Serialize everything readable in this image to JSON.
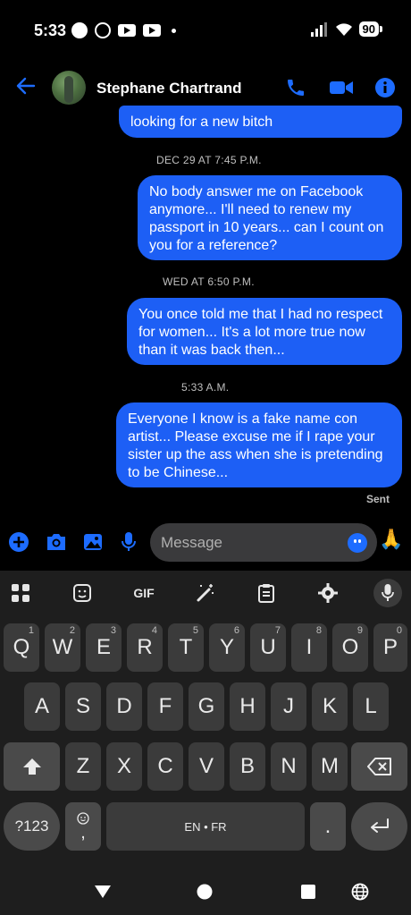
{
  "status_bar": {
    "time": "5:33",
    "battery": "90"
  },
  "header": {
    "contact_name": "Stephane Chartrand"
  },
  "messages": [
    {
      "type": "bubble",
      "text": "looking for a new bitch"
    },
    {
      "type": "timestamp",
      "text": "DEC 29 AT 7:45 P.M."
    },
    {
      "type": "bubble",
      "text": "No body answer me on Facebook anymore... I'll need to renew my passport in 10 years... can I count on you for a reference?"
    },
    {
      "type": "timestamp",
      "text": "WED AT 6:50 P.M."
    },
    {
      "type": "bubble",
      "text": "You once told me that I had no respect for women... It's a lot more true now than it was back then..."
    },
    {
      "type": "timestamp",
      "text": "5:33 A.M."
    },
    {
      "type": "bubble",
      "text": "Everyone I know is a fake name con artist... Please excuse me if I rape your sister up the ass when she is pretending to be Chinese..."
    }
  ],
  "sent_label": "Sent",
  "composer": {
    "placeholder": "Message",
    "quick_reaction": "🙏"
  },
  "keyboard": {
    "toolbar": {
      "gif": "GIF"
    },
    "row1": [
      {
        "k": "Q",
        "h": "1"
      },
      {
        "k": "W",
        "h": "2"
      },
      {
        "k": "E",
        "h": "3"
      },
      {
        "k": "R",
        "h": "4"
      },
      {
        "k": "T",
        "h": "5"
      },
      {
        "k": "Y",
        "h": "6"
      },
      {
        "k": "U",
        "h": "7"
      },
      {
        "k": "I",
        "h": "8"
      },
      {
        "k": "O",
        "h": "9"
      },
      {
        "k": "P",
        "h": "0"
      }
    ],
    "row2": [
      "A",
      "S",
      "D",
      "F",
      "G",
      "H",
      "J",
      "K",
      "L"
    ],
    "row3": [
      "Z",
      "X",
      "C",
      "V",
      "B",
      "N",
      "M"
    ],
    "symbols": "?123",
    "comma": ",",
    "space": "EN • FR",
    "period": "."
  },
  "colors": {
    "accent": "#1d6cff",
    "bubble": "#1d5ff5",
    "keyboard_bg": "#1e1e1e",
    "key": "#3b3b3b"
  }
}
